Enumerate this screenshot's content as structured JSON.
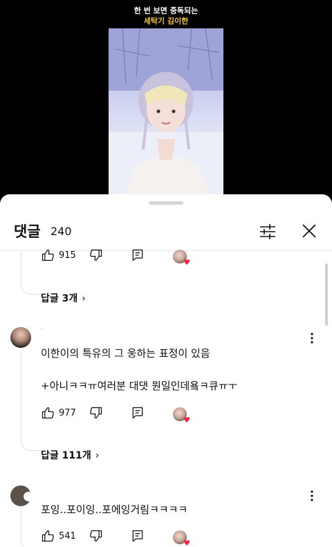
{
  "video": {
    "caption_line1": "한 번 보면 중독되는",
    "caption_line2": "세탁기 김이한"
  },
  "comments_panel": {
    "title": "댓글",
    "count": "240",
    "filter_icon": "sliders-icon",
    "close_icon": "close-icon"
  },
  "comments": [
    {
      "likes": "915",
      "replies_label": "답글 3개"
    },
    {
      "username": "·",
      "text_line1": "이한이의 특유의 그 웅하는 표정이 있음",
      "text_line2": "+아니ㅋㅋㅠ여러분 대댓 뭔일인데욬ㅋ큐ㅠㅜ",
      "likes": "977",
      "replies_label": "답글 111개"
    },
    {
      "text": "포잉..포이잉..포에잉거림ㅋㅋㅋㅋ",
      "likes": "541"
    }
  ],
  "colors": {
    "caption_highlight": "#f6c338",
    "heart": "#ff1e3c"
  }
}
